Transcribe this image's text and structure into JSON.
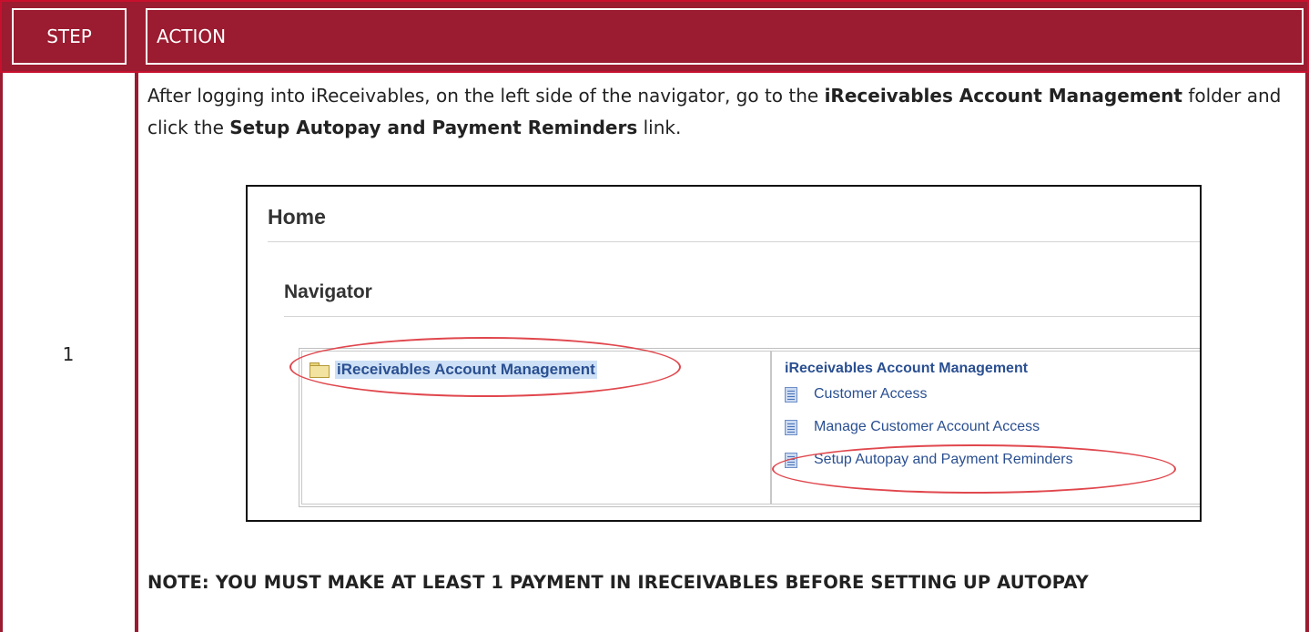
{
  "table": {
    "header": {
      "step": "STEP",
      "action": "ACTION"
    },
    "row": {
      "step_number": "1",
      "intro_1": "After logging into iReceivables, on the left side of the navigator, go to the ",
      "intro_bold_1": "iReceivables Account Management",
      "intro_2": " folder and click the ",
      "intro_bold_2": "Setup Autopay and Payment Reminders",
      "intro_3": " link.",
      "note": "NOTE: YOU MUST MAKE AT LEAST 1 PAYMENT IN IRECEIVABLES BEFORE SETTING UP AUTOPAY"
    }
  },
  "screenshot": {
    "home_title": "Home",
    "navigator_title": "Navigator",
    "folder_label": "iReceivables Account Management",
    "section_title": "iReceivables Account Management",
    "items": [
      {
        "label": "Customer Access",
        "icon": "page-icon"
      },
      {
        "label": "Manage Customer Account Access",
        "icon": "page-icon"
      },
      {
        "label": "Setup Autopay and Payment Reminders",
        "icon": "page-icon"
      }
    ],
    "folder_icon": "folder-icon",
    "highlight_color": "#e0474d"
  },
  "colors": {
    "header_bg": "#9b1b30",
    "border": "#c8102e",
    "link": "#2a4f91"
  }
}
